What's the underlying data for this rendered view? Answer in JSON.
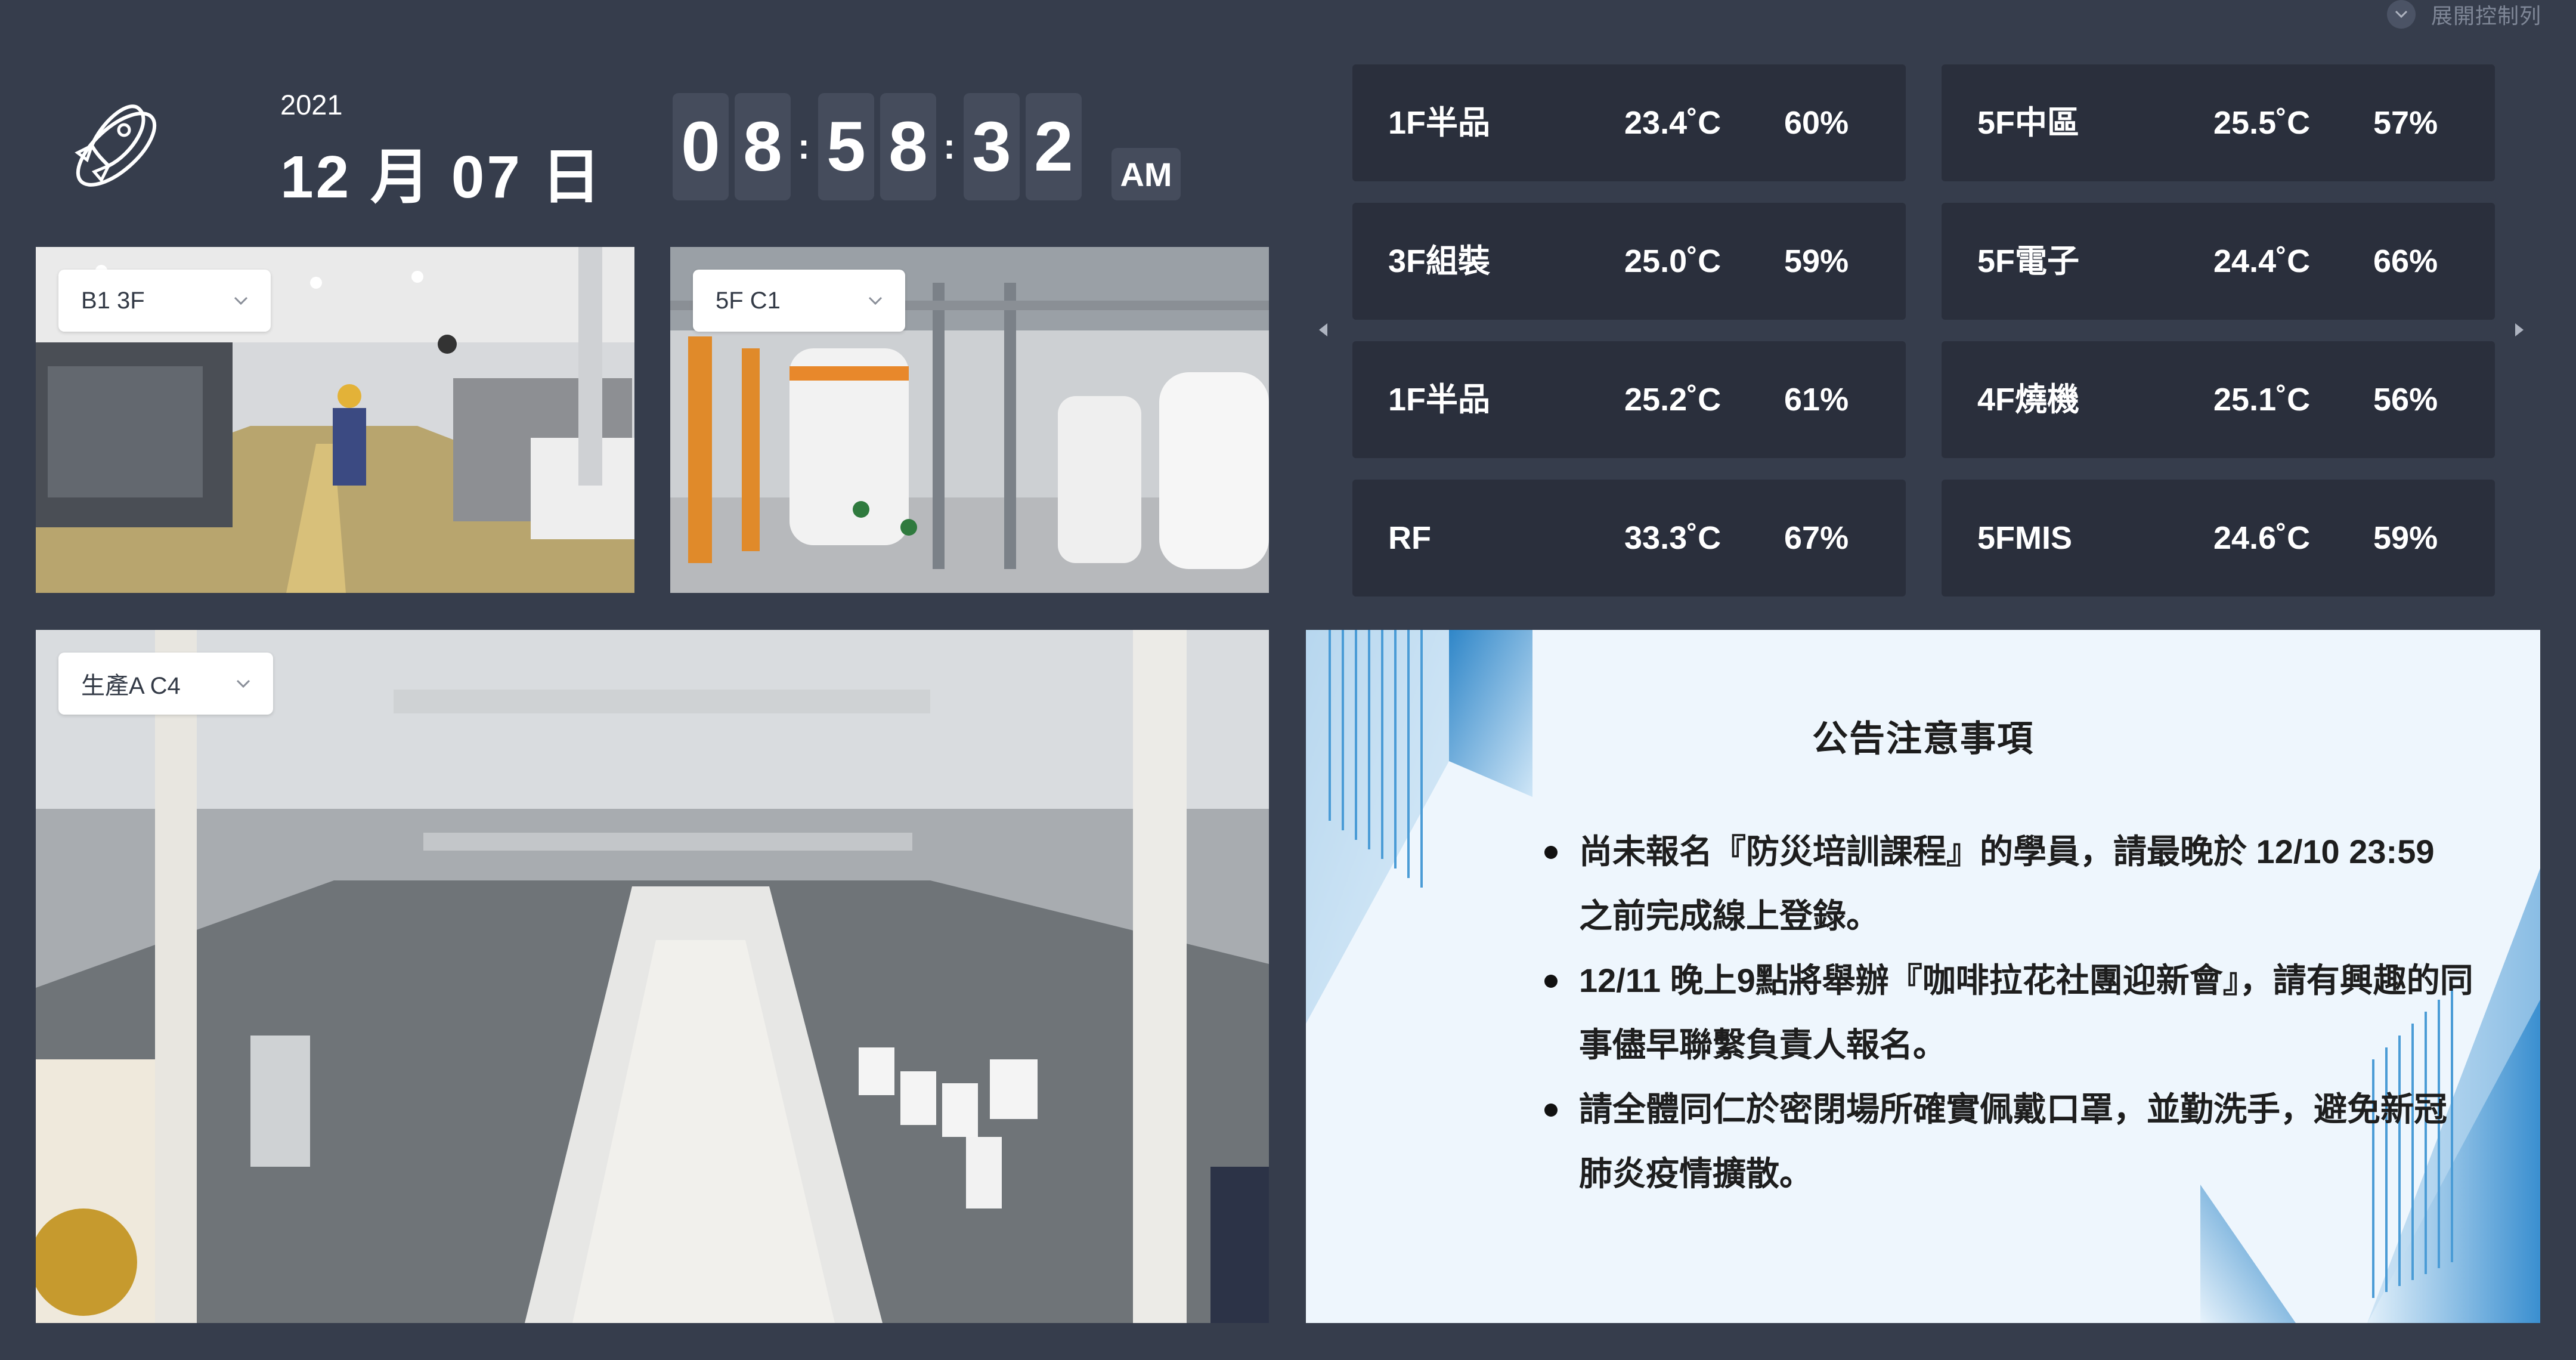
{
  "controls": {
    "expand_label": "展開控制列",
    "chevron_icon": "chevron-down-icon"
  },
  "logo": {
    "icon": "rocket-orbit-icon"
  },
  "date": {
    "year": "2021",
    "display": "12 月 07 日"
  },
  "clock": {
    "digits": [
      "0",
      "8",
      "5",
      "8",
      "3",
      "2"
    ],
    "separator": ":",
    "ampm": "AM"
  },
  "cameras": [
    {
      "id": "cam1",
      "selected": "B1 3F"
    },
    {
      "id": "cam2",
      "selected": "5F C1"
    },
    {
      "id": "cam3",
      "selected": "生產A C4"
    }
  ],
  "sensors": [
    {
      "name": "1F半品",
      "temp": "23.4˚C",
      "humidity": "60%"
    },
    {
      "name": "5F中區",
      "temp": "25.5˚C",
      "humidity": "57%"
    },
    {
      "name": "3F組裝",
      "temp": "25.0˚C",
      "humidity": "59%"
    },
    {
      "name": "5F電子",
      "temp": "24.4˚C",
      "humidity": "66%"
    },
    {
      "name": "1F半品",
      "temp": "25.2˚C",
      "humidity": "61%"
    },
    {
      "name": "4F燒機",
      "temp": "25.1˚C",
      "humidity": "56%"
    },
    {
      "name": "RF",
      "temp": "33.3˚C",
      "humidity": "67%"
    },
    {
      "name": "5FMIS",
      "temp": "24.6˚C",
      "humidity": "59%"
    }
  ],
  "nav": {
    "prev_icon": "caret-left-icon",
    "next_icon": "caret-right-icon"
  },
  "notice": {
    "title": "公告注意事項",
    "items": [
      "尚未報名『防災培訓課程』的學員，請最晚於 12/10 23:59 之前完成線上登錄。",
      "12/11 晚上9點將舉辦『咖啡拉花社團迎新會』，請有興趣的同事儘早聯繫負責人報名。",
      "請全體同仁於密閉場所確實佩戴口罩，並勤洗手，避免新冠肺炎疫情擴散。"
    ]
  },
  "colors": {
    "background": "#363d4c",
    "tile": "#2a2f3c",
    "digit_box": "#454c5c",
    "notice_bg": "#eef6fd",
    "notice_accent": "#3a8fd0"
  }
}
